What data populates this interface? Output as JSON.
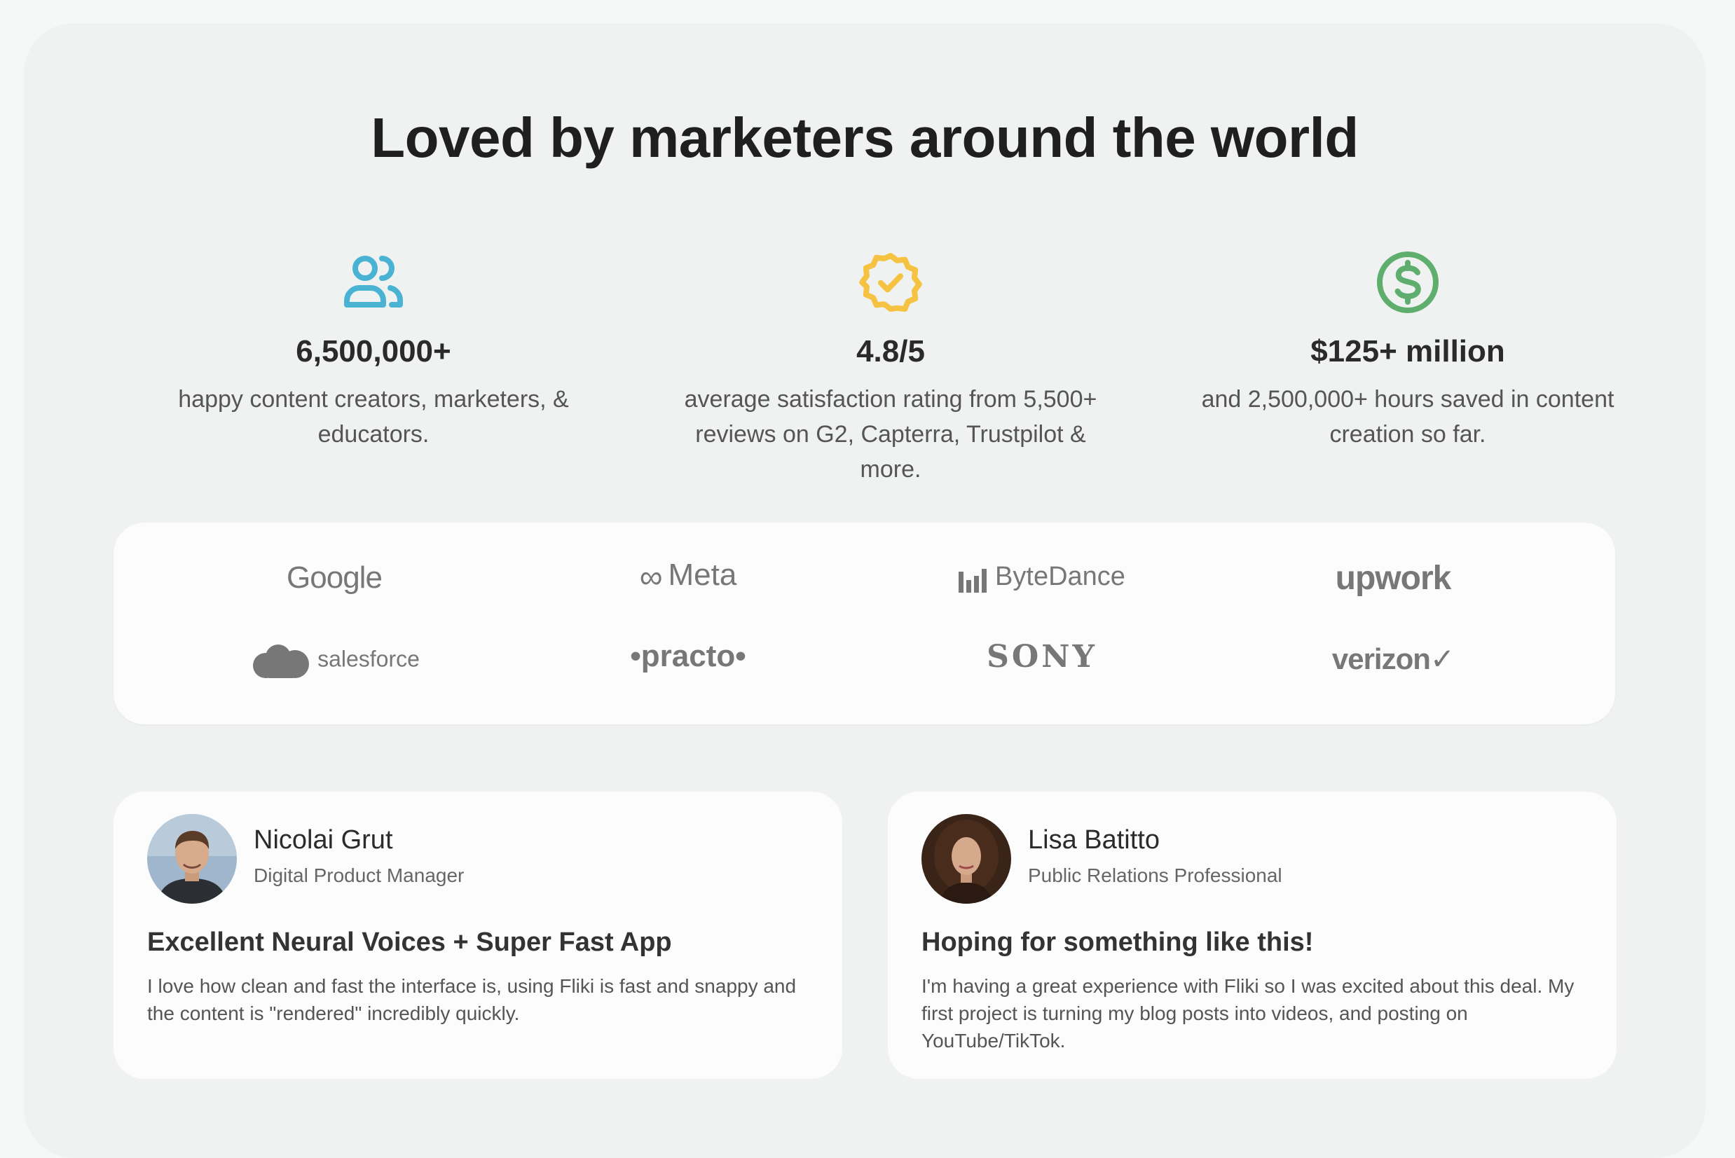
{
  "headline": "Loved by marketers around the world",
  "colors": {
    "users": "#4ab3d3",
    "rating": "#f5c242",
    "money": "#5fae6d"
  },
  "stats": [
    {
      "icon": "users-icon",
      "value": "6,500,000+",
      "desc": "happy content creators, marketers, & educators."
    },
    {
      "icon": "verified-badge-icon",
      "value": "4.8/5",
      "desc": "average satisfaction rating from 5,500+ reviews on G2, Capterra, Trustpilot & more."
    },
    {
      "icon": "dollar-circle-icon",
      "value": "$125+ million",
      "desc": "and 2,500,000+ hours saved in content creation so far."
    }
  ],
  "logos": {
    "google": "Google",
    "meta": "Meta",
    "bytedance": "ByteDance",
    "upwork": "upwork",
    "salesforce": "salesforce",
    "practo": "•practo•",
    "sony": "SONY",
    "verizon": "verizon✓"
  },
  "testimonials": [
    {
      "name": "Nicolai Grut",
      "role": "Digital Product Manager",
      "title": "Excellent Neural Voices + Super Fast App",
      "body": "I love how clean and fast the interface is, using Fliki is fast and snappy and the content is \"rendered\" incredibly quickly."
    },
    {
      "name": "Lisa Batitto",
      "role": "Public Relations Professional",
      "title": "Hoping for something like this!",
      "body": "I'm having a great experience with Fliki so I was excited about this deal. My first project is turning my blog posts into videos, and posting on YouTube/TikTok."
    }
  ]
}
